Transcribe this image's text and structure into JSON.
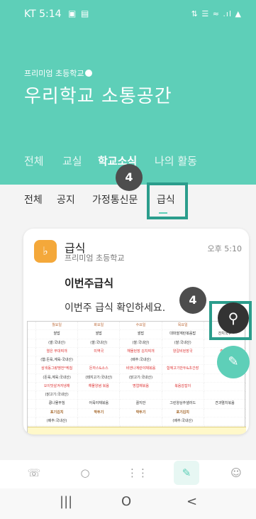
{
  "status_bar": {
    "time": "KT 5:14",
    "right": "N∕∕∕"
  },
  "school": {
    "label": "프리미엄 초등학교",
    "title": "우리학교 소통공간"
  },
  "main_tabs": [
    "전체",
    "교실",
    "학교소식",
    "나의 활동"
  ],
  "sub_tabs": [
    "전체",
    "공지",
    "가정통신문",
    "급식"
  ],
  "badges": [
    "4",
    "4"
  ],
  "post": {
    "channel": "급식",
    "school": "프리미엄 초등학교",
    "time": "오후 5:10",
    "title": "이번주급식",
    "body": "이번주 급식 확인하세요."
  },
  "menu_image": {
    "day_headers": [
      "월요일",
      "화요일",
      "수요일",
      "목요일",
      "금요일"
    ],
    "rows": [
      [
        "쌀밥",
        "쌀밥",
        "쌀밥",
        "대파쌀계란볶음밥",
        "잔치국수"
      ],
      [
        "(쌀:국내산)",
        "(쌀:국내산)",
        "(쌀:국내산)",
        "(쌀:국내산)",
        ""
      ],
      [
        "열은 부대찌개",
        "미역국",
        "해물된장 김치찌개",
        "양갈비된장국",
        "추가밥"
      ],
      [
        "(햄:돈육,계육-국내산)",
        "",
        "(배추:국내산)",
        "",
        ""
      ],
      [
        "삼색동그랑땡전*케첩",
        "돈까스&소스",
        "비엔나계란야채볶음",
        "함께고기만두&초간장",
        ""
      ],
      [
        "(돈육,계육:국내산)",
        "(돼지고기:국내산)",
        "(닭고기:국내산)",
        "",
        ""
      ],
      [
        "오이맛살겨자냉채",
        "해물양념 볶음",
        "명엽채볶음",
        "볶음감잡이",
        ""
      ],
      [
        "(닭고기:국내산)",
        "",
        "",
        "",
        ""
      ],
      [
        "콩나물무침",
        "어묵야채볶음",
        "꿀지만",
        "그린양상추샐러드",
        "견과멸치볶음"
      ],
      [
        "포기김치",
        "깍두기",
        "깍두기",
        "포기김치",
        ""
      ],
      [
        "(배추:국내산)",
        "",
        "",
        "(배추:국내산)",
        ""
      ],
      [
        "",
        "",
        "",
        "",
        ""
      ]
    ]
  },
  "fab": {
    "search_icon": "search-icon",
    "write_icon": "pencil-icon"
  },
  "bottom_nav": [
    "phone-icon",
    "chat-icon",
    "grid-icon",
    "pencil-icon",
    "person-icon"
  ],
  "android_nav": [
    "|||",
    "O",
    "<"
  ],
  "colors": {
    "accent": "#5ecfb8",
    "highlight": "#2b9d8c",
    "badge": "#4d4d4d"
  }
}
